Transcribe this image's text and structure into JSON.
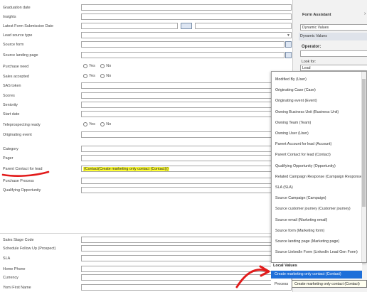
{
  "form": {
    "rows": [
      {
        "label": "Graduation date",
        "type": "text"
      },
      {
        "label": "Insights",
        "type": "text"
      },
      {
        "label": "Latest Form Submission Date",
        "type": "date"
      },
      {
        "label": "Lead source type",
        "type": "select"
      },
      {
        "label": "Source form",
        "type": "lookup"
      },
      {
        "label": "Source landing page",
        "type": "lookup"
      },
      {
        "label": "Purchase need",
        "type": "radio"
      },
      {
        "label": "Sales accepted",
        "type": "radio"
      },
      {
        "label": "SAS token",
        "type": "text"
      },
      {
        "label": "Scores",
        "type": "text"
      },
      {
        "label": "Seniority",
        "type": "text"
      },
      {
        "label": "Start date",
        "type": "text"
      },
      {
        "label": "Teleprospecting ready",
        "type": "radio"
      },
      {
        "label": "Originating event",
        "type": "text"
      },
      {
        "label": "Category",
        "type": "text"
      },
      {
        "label": "Pager",
        "type": "text"
      },
      {
        "label": "Parent Contact for lead",
        "type": "highlight",
        "value": "{Contact(Create marketing only contact (Contact))}"
      },
      {
        "label": "Purchase Process",
        "type": "text"
      },
      {
        "label": "Qualifying Opportunity",
        "type": "text"
      }
    ],
    "lower_rows": [
      {
        "label": "Sales Stage Code"
      },
      {
        "label": "Schedule Follow Up (Prospect)"
      },
      {
        "label": "SLA"
      },
      {
        "label": "Home Phone"
      },
      {
        "label": "Currency"
      },
      {
        "label": "Yomi First Name"
      }
    ],
    "radio_yes": "Yes",
    "radio_no": "No"
  },
  "assistant": {
    "title": "Form Assistant",
    "select1": "Dynamic Values",
    "section": "Dynamic Values",
    "operator": "Operator:",
    "look_for": "Look for:",
    "look_value": "Lead"
  },
  "dropdown": {
    "items": [
      "Modified By (User)",
      "Originating Case (Case)",
      "Originating event (Event)",
      "Owning Business Unit (Business Unit)",
      "Owning Team (Team)",
      "Owning User (User)",
      "Parent Account for lead (Account)",
      "Parent Contact for lead (Contact)",
      "Qualifying Opportunity (Opportunity)",
      "Related Campaign Response (Campaign Response)",
      "SLA (SLA)",
      "Source Campaign (Campaign)",
      "Source customer journey (Customer journey)",
      "Source email (Marketing email)",
      "Source form (Marketing form)",
      "Source landing page (Marketing page)",
      "Source LinkedIn Form (LinkedIn Lead Gen Form)"
    ],
    "section_label": "Local Values",
    "selected_item": "Create marketing only contact (Contact)",
    "tooltip": "Create marketing only contact (Contact)",
    "behind_label": "Process"
  },
  "colors": {
    "highlight": "#ffff33",
    "selected": "#1e6fd9",
    "annotation": "#e21b1b"
  }
}
